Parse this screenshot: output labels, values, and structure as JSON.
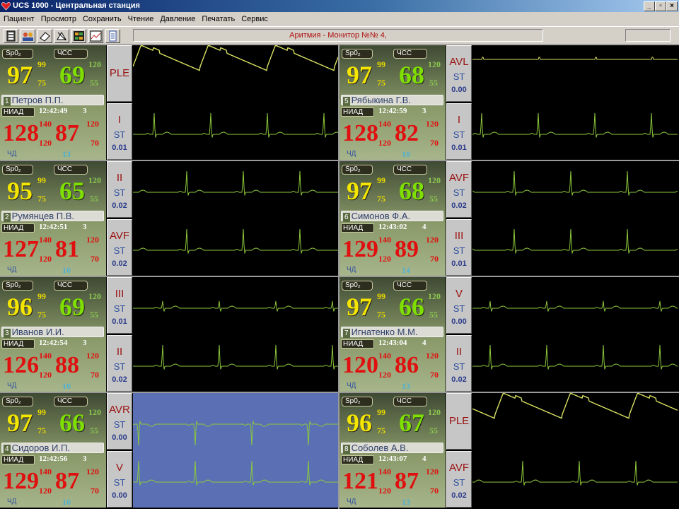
{
  "window": {
    "title": "UCS 1000 - Центральная станция"
  },
  "menu": [
    "Пациент",
    "Просмотр",
    "Сохранить",
    "Чтение",
    "Давление",
    "Печатать",
    "Сервис"
  ],
  "toolbar": {
    "icons": [
      "patient-card-icon",
      "patients-group-icon",
      "erase-icon",
      "connect-icon",
      "monitor-grid-icon",
      "trend-chart-icon",
      "notepad-icon"
    ],
    "alarm_message": "Аритмия - Монитор №№ 4,"
  },
  "labels": {
    "spo2": "Sp0₂",
    "hr": "ЧСС",
    "niad": "НИАД",
    "st": "ST",
    "rr": "ЧД"
  },
  "patients": [
    {
      "num": "1",
      "name": "Петров П.П.",
      "spo2": "97",
      "spo2_hi": "99",
      "spo2_lo": "75",
      "hr": "69",
      "hr_hi": "120",
      "hr_lo": "55",
      "time": "12:42:49",
      "tnum": "3",
      "sys": "128",
      "dia": "87",
      "sys_hi": "140",
      "sys_lo": "120",
      "dia_hi": "120",
      "dia_lo": "70",
      "rr": "13",
      "leads": [
        {
          "name": "PLE",
          "st": "",
          "wave": "ple"
        },
        {
          "name": "I",
          "st": "0.01",
          "wave": "ecg"
        }
      ]
    },
    {
      "num": "5",
      "name": "Рябыкина Г.В.",
      "spo2": "97",
      "spo2_hi": "99",
      "spo2_lo": "75",
      "hr": "68",
      "hr_hi": "120",
      "hr_lo": "55",
      "time": "12:42:59",
      "tnum": "3",
      "sys": "128",
      "dia": "82",
      "sys_hi": "140",
      "sys_lo": "120",
      "dia_hi": "120",
      "dia_lo": "70",
      "rr": "10",
      "leads": [
        {
          "name": "AVL",
          "st": "0.00",
          "wave": "flat"
        },
        {
          "name": "I",
          "st": "0.01",
          "wave": "ecg"
        }
      ]
    },
    {
      "num": "2",
      "name": "Румянцев П.В.",
      "spo2": "95",
      "spo2_hi": "99",
      "spo2_lo": "75",
      "hr": "65",
      "hr_hi": "120",
      "hr_lo": "55",
      "time": "12:42:51",
      "tnum": "3",
      "sys": "127",
      "dia": "81",
      "sys_hi": "140",
      "sys_lo": "120",
      "dia_hi": "120",
      "dia_lo": "70",
      "rr": "10",
      "leads": [
        {
          "name": "II",
          "st": "0.02",
          "wave": "ecg"
        },
        {
          "name": "AVF",
          "st": "0.02",
          "wave": "ecg"
        }
      ]
    },
    {
      "num": "6",
      "name": "Симонов Ф.А.",
      "spo2": "97",
      "spo2_hi": "99",
      "spo2_lo": "75",
      "hr": "68",
      "hr_hi": "120",
      "hr_lo": "55",
      "time": "12:43:02",
      "tnum": "4",
      "sys": "129",
      "dia": "89",
      "sys_hi": "140",
      "sys_lo": "120",
      "dia_hi": "120",
      "dia_lo": "70",
      "rr": "14",
      "leads": [
        {
          "name": "AVF",
          "st": "0.02",
          "wave": "ecg"
        },
        {
          "name": "III",
          "st": "0.01",
          "wave": "ecg"
        }
      ]
    },
    {
      "num": "3",
      "name": "Иванов И.И.",
      "spo2": "96",
      "spo2_hi": "99",
      "spo2_lo": "75",
      "hr": "69",
      "hr_hi": "120",
      "hr_lo": "55",
      "time": "12:42:54",
      "tnum": "3",
      "sys": "126",
      "dia": "88",
      "sys_hi": "140",
      "sys_lo": "120",
      "dia_hi": "120",
      "dia_lo": "70",
      "rr": "10",
      "leads": [
        {
          "name": "III",
          "st": "0.01",
          "wave": "ecg-small"
        },
        {
          "name": "II",
          "st": "0.02",
          "wave": "ecg"
        }
      ]
    },
    {
      "num": "7",
      "name": "Игнатенко М.М.",
      "spo2": "97",
      "spo2_hi": "99",
      "spo2_lo": "75",
      "hr": "66",
      "hr_hi": "120",
      "hr_lo": "55",
      "time": "12:43:04",
      "tnum": "4",
      "sys": "120",
      "dia": "86",
      "sys_hi": "140",
      "sys_lo": "120",
      "dia_hi": "120",
      "dia_lo": "70",
      "rr": "13",
      "leads": [
        {
          "name": "V",
          "st": "0.00",
          "wave": "ecg-small"
        },
        {
          "name": "II",
          "st": "0.02",
          "wave": "ecg"
        }
      ]
    },
    {
      "num": "4",
      "name": "Сидоров И.П.",
      "spo2": "97",
      "spo2_hi": "99",
      "spo2_lo": "75",
      "hr": "66",
      "hr_hi": "120",
      "hr_lo": "55",
      "time": "12:42:56",
      "tnum": "3",
      "sys": "129",
      "dia": "87",
      "sys_hi": "140",
      "sys_lo": "120",
      "dia_hi": "120",
      "dia_lo": "70",
      "rr": "10",
      "selected": true,
      "leads": [
        {
          "name": "AVR",
          "st": "0.00",
          "wave": "ecg-inv"
        },
        {
          "name": "V",
          "st": "0.00",
          "wave": "ecg"
        }
      ]
    },
    {
      "num": "8",
      "name": "Соболев А.В.",
      "spo2": "96",
      "spo2_hi": "99",
      "spo2_lo": "75",
      "hr": "67",
      "hr_hi": "120",
      "hr_lo": "55",
      "time": "12:43:07",
      "tnum": "4",
      "sys": "121",
      "dia": "87",
      "sys_hi": "140",
      "sys_lo": "120",
      "dia_hi": "120",
      "dia_lo": "70",
      "rr": "13",
      "leads": [
        {
          "name": "PLE",
          "st": "",
          "wave": "ple"
        },
        {
          "name": "AVF",
          "st": "0.02",
          "wave": "ecg"
        }
      ]
    }
  ],
  "colors": {
    "wave": "#d8e060",
    "ecg": "#8cc83c",
    "selected_bg": "#5b6fb5"
  }
}
